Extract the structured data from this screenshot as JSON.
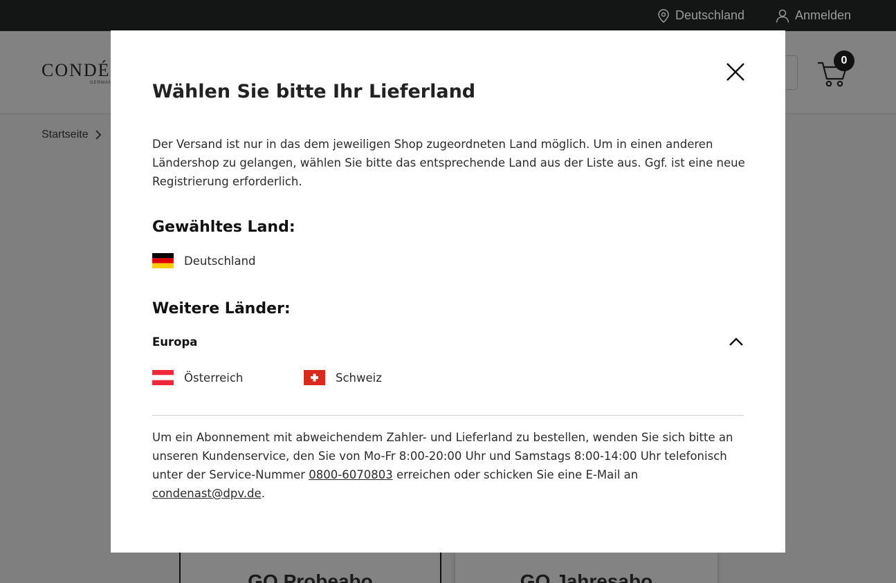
{
  "topbar": {
    "country_label": "Deutschland",
    "login_label": "Anmelden"
  },
  "header": {
    "logo_text": "CONDÉ",
    "logo_sub": "GERMANY",
    "cart_count": "0"
  },
  "breadcrumb": {
    "home": "Startseite"
  },
  "cards": [
    {
      "title": "GQ Probeabo"
    },
    {
      "title": "GQ Jahresabo"
    }
  ],
  "modal": {
    "title": "Wählen Sie bitte Ihr Lieferland",
    "intro": "Der Versand ist nur in das dem jeweiligen Shop zugeordneten Land möglich. Um in einen anderen Ländershop zu gelangen, wählen Sie bitte das entsprechende Land aus der Liste aus. Ggf. ist eine neue Registrierung erforderlich.",
    "selected_heading": "Gewähltes Land:",
    "selected_country": "Deutschland",
    "other_heading": "Weitere Länder:",
    "region": "Europa",
    "countries": [
      {
        "name": "Österreich"
      },
      {
        "name": "Schweiz"
      }
    ],
    "footer": {
      "part1": "Um ein Abonnement mit abweichendem Zahler- und Lieferland zu bestellen, wenden Sie sich bitte an unseren Kundenservice, den Sie von Mo-Fr 8:00-20:00 Uhr und Samstags 8:00-14:00 Uhr telefonisch unter der Service-Nummer ",
      "phone": "0800-6070803",
      "part2": " erreichen oder schicken Sie eine E-Mail an ",
      "email": "condenast@dpv.de",
      "part3": "."
    }
  },
  "colors": {
    "overlay": "#7f7f7f",
    "topbar": "#141616",
    "flag_de": [
      "#000000",
      "#dd0000",
      "#ffce00"
    ],
    "flag_at": "#ed2939",
    "flag_ch": "#da291c"
  },
  "icons": [
    "location-pin-icon",
    "user-icon",
    "cart-icon",
    "close-icon",
    "chevron-up-icon",
    "chevron-right-icon"
  ]
}
